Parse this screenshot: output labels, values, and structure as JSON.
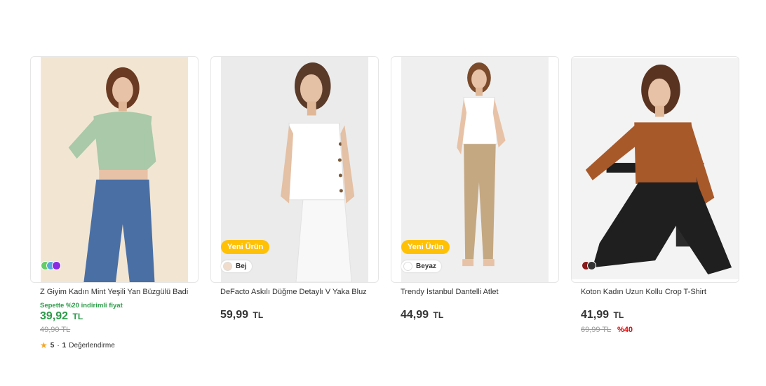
{
  "products": [
    {
      "title": "Z Giyim Kadın Mint Yeşili Yan Büzgülü Badi",
      "promo": "Sepette %20 indirimli fiyat",
      "price": "39,92",
      "currency": "TL",
      "old_price": "49,90 TL",
      "rating_score": "5",
      "rating_sep": "·",
      "rating_count": "1",
      "rating_label": "Değerlendirme",
      "swatch_colors": [
        "#66cc66",
        "#55aadd",
        "#8a2be2"
      ]
    },
    {
      "badge": "Yeni Ürün",
      "color_label": "Bej",
      "color_hex": "#f1dccb",
      "title": "DeFacto Askılı Düğme Detaylı V Yaka Bluz",
      "price": "59,99",
      "currency": "TL"
    },
    {
      "badge": "Yeni Ürün",
      "color_label": "Beyaz",
      "color_hex": "#ffffff",
      "title": "Trendy İstanbul Dantelli Atlet",
      "price": "44,99",
      "currency": "TL"
    },
    {
      "title": "Koton Kadın Uzun Kollu Crop T-Shirt",
      "price": "41,99",
      "currency": "TL",
      "old_price": "69,99 TL",
      "discount": "%40",
      "swatch_colors": [
        "#8b1a1a",
        "#333333"
      ]
    }
  ],
  "colors": {
    "badge_yellow": "#ffc107",
    "promo_green": "#2d9b4a",
    "discount_red": "#e60000",
    "star": "#f5a623"
  }
}
